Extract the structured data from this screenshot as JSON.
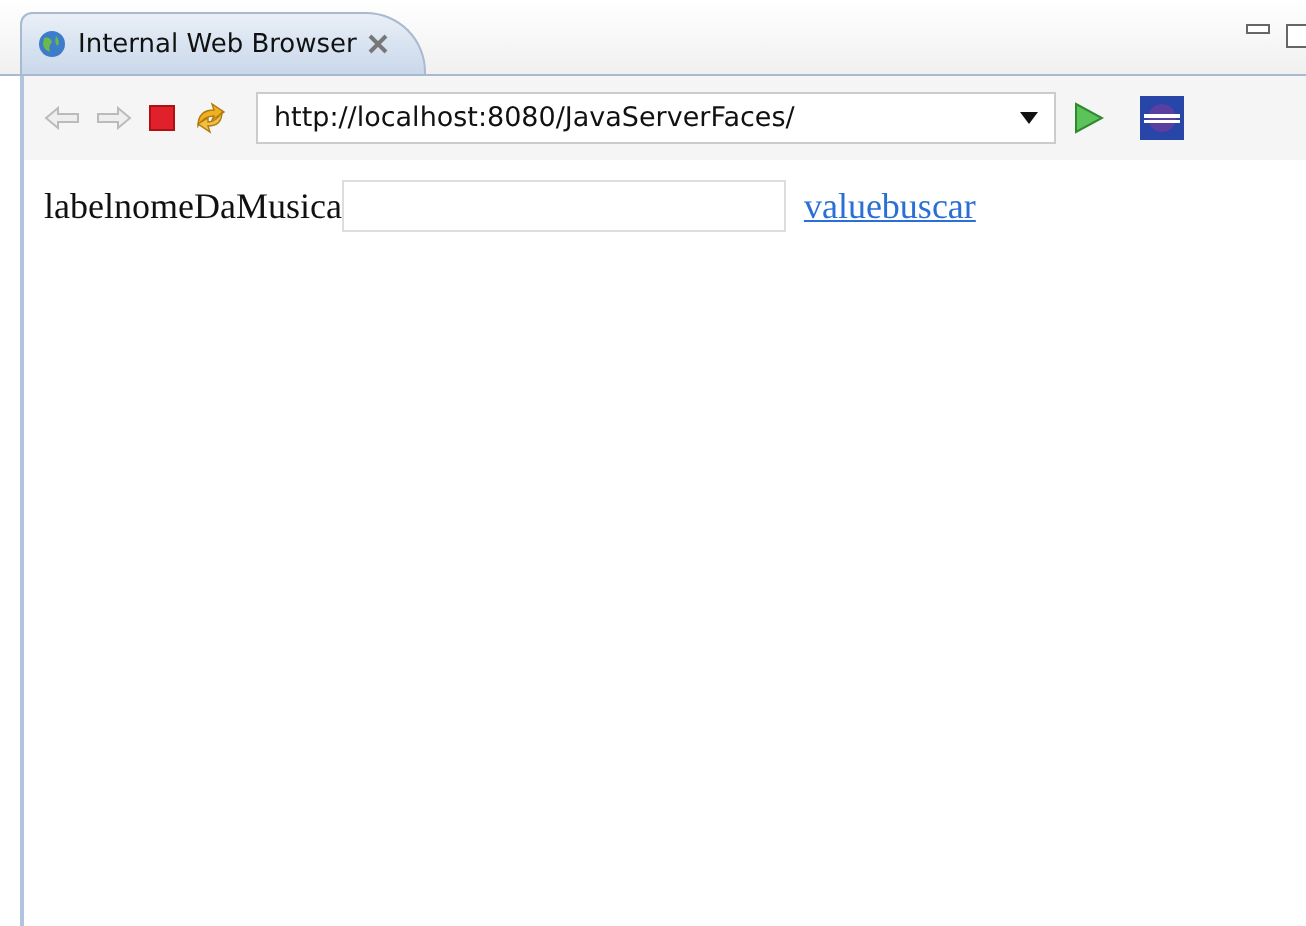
{
  "tab": {
    "title": "Internal Web Browser"
  },
  "address_bar": {
    "url": "http://localhost:8080/JavaServerFaces/"
  },
  "page": {
    "label": "labelnomeDaMusica",
    "link": "valuebuscar"
  }
}
